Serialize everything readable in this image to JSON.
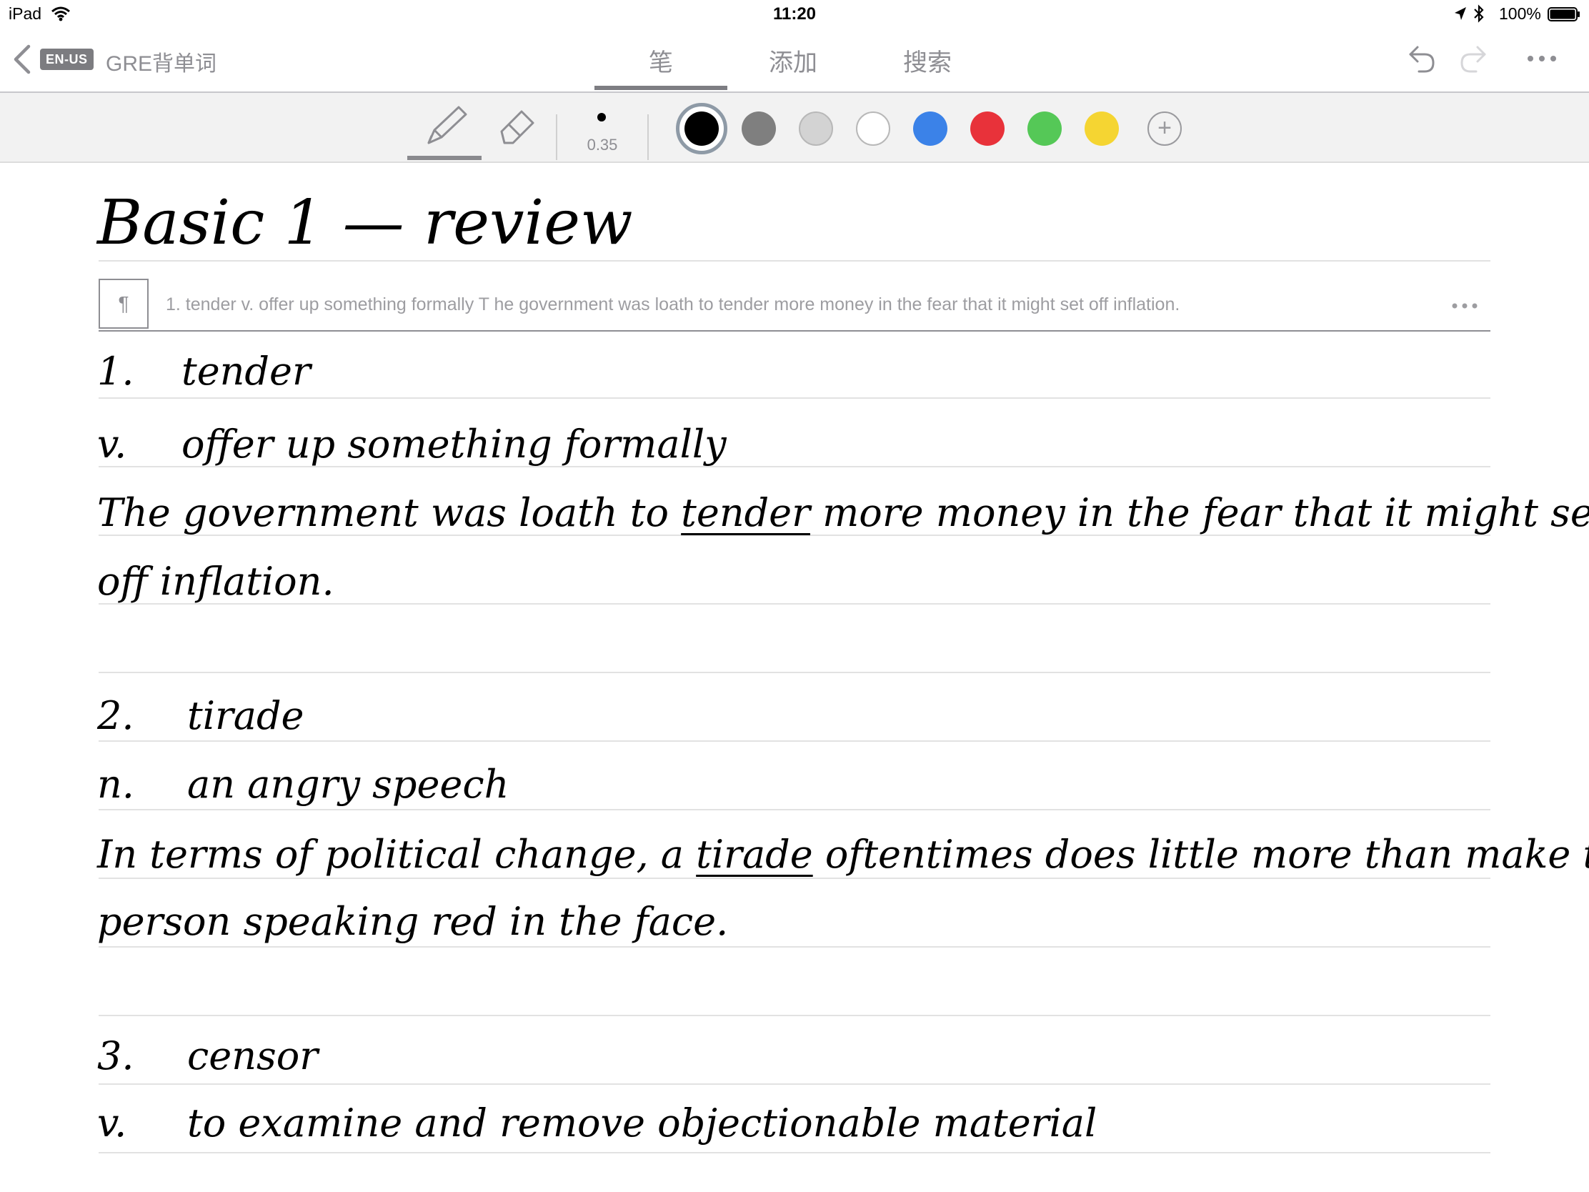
{
  "status_bar": {
    "device": "iPad",
    "time": "11:20",
    "battery": "100%"
  },
  "nav": {
    "language_badge": "EN-US",
    "note_title": "GRE背单词",
    "tabs": [
      {
        "label": "笔",
        "active": true
      },
      {
        "label": "添加",
        "active": false
      },
      {
        "label": "搜索",
        "active": false
      }
    ]
  },
  "toolbar": {
    "selected_tool": "pen",
    "stroke_size": "0.35",
    "colors": [
      "#000000",
      "#7f7f7f",
      "#d3d3d3",
      "#ffffff",
      "#3b82e8",
      "#e8323a",
      "#55c857",
      "#f5d532"
    ],
    "selected_color": "#000000"
  },
  "note": {
    "heading": "Basic 1 — review",
    "recognized_text": "1. tender v. offer up something formally T he government was loath to tender more money in the fear that it might set off inflation.",
    "entries": [
      {
        "number": "1.",
        "word": "tender",
        "pos": "v.",
        "definition": "offer up something formally",
        "example_before": "The government was loath to ",
        "example_word": "tender",
        "example_after": " more money in the fear that it might set",
        "example_cont": "off inflation."
      },
      {
        "number": "2.",
        "word": "tirade",
        "pos": "n.",
        "definition": "an angry speech",
        "example_before": "In terms of political change, a ",
        "example_word": "tirade",
        "example_after": " oftentimes does little more than make the",
        "example_cont": "person speaking red in the face."
      },
      {
        "number": "3.",
        "word": "censor",
        "pos": "v.",
        "definition": "to examine and remove objectionable material"
      }
    ]
  }
}
